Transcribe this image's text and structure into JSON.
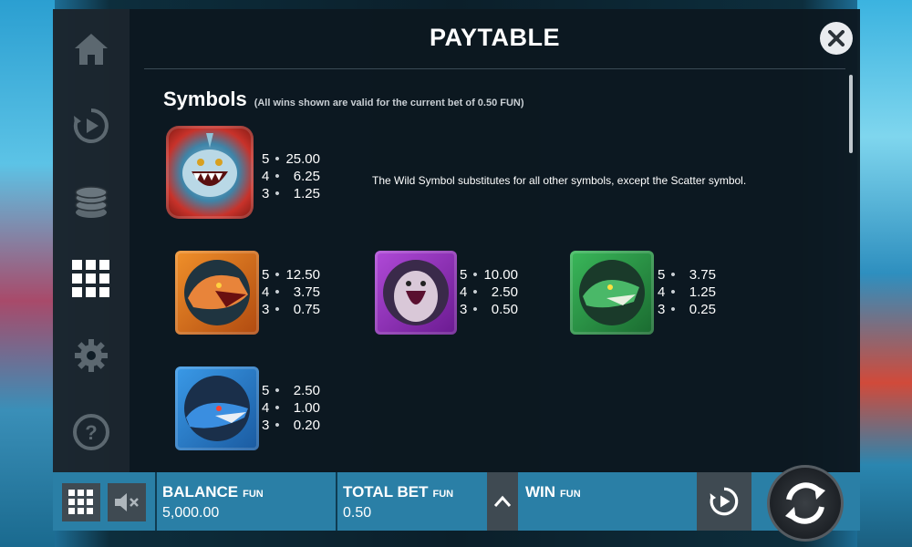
{
  "header": {
    "title": "PAYTABLE"
  },
  "section": {
    "heading": "Symbols",
    "note": "(All wins shown are valid for the current bet of 0.50 FUN)"
  },
  "wild": {
    "description": "The Wild Symbol substitutes for all other symbols, except the Scatter symbol.",
    "pays": [
      {
        "count": "5",
        "value": "25.00"
      },
      {
        "count": "4",
        "value": "6.25"
      },
      {
        "count": "3",
        "value": "1.25"
      }
    ]
  },
  "symbols": [
    {
      "name": "orange-shark",
      "color": "#e0721e",
      "pays": [
        {
          "count": "5",
          "value": "12.50"
        },
        {
          "count": "4",
          "value": "3.75"
        },
        {
          "count": "3",
          "value": "0.75"
        }
      ]
    },
    {
      "name": "purple-shark",
      "color": "#9a2fbf",
      "pays": [
        {
          "count": "5",
          "value": "10.00"
        },
        {
          "count": "4",
          "value": "2.50"
        },
        {
          "count": "3",
          "value": "0.50"
        }
      ]
    },
    {
      "name": "green-shark",
      "color": "#2c9a48",
      "pays": [
        {
          "count": "5",
          "value": "3.75"
        },
        {
          "count": "4",
          "value": "1.25"
        },
        {
          "count": "3",
          "value": "0.25"
        }
      ]
    },
    {
      "name": "blue-shark",
      "color": "#2c7fd0",
      "pays": [
        {
          "count": "5",
          "value": "2.50"
        },
        {
          "count": "4",
          "value": "1.00"
        },
        {
          "count": "3",
          "value": "0.20"
        }
      ]
    }
  ],
  "bottom_bar": {
    "balance_label": "BALANCE",
    "balance_currency": "FUN",
    "balance_value": "5,000.00",
    "total_bet_label": "TOTAL BET",
    "total_bet_currency": "FUN",
    "total_bet_value": "0.50",
    "win_label": "WIN",
    "win_currency": "FUN"
  },
  "colors": {
    "panel_bg": "#0c1820",
    "bottom_bar": "#2a7fa6",
    "button_dark": "#3f4a52"
  }
}
